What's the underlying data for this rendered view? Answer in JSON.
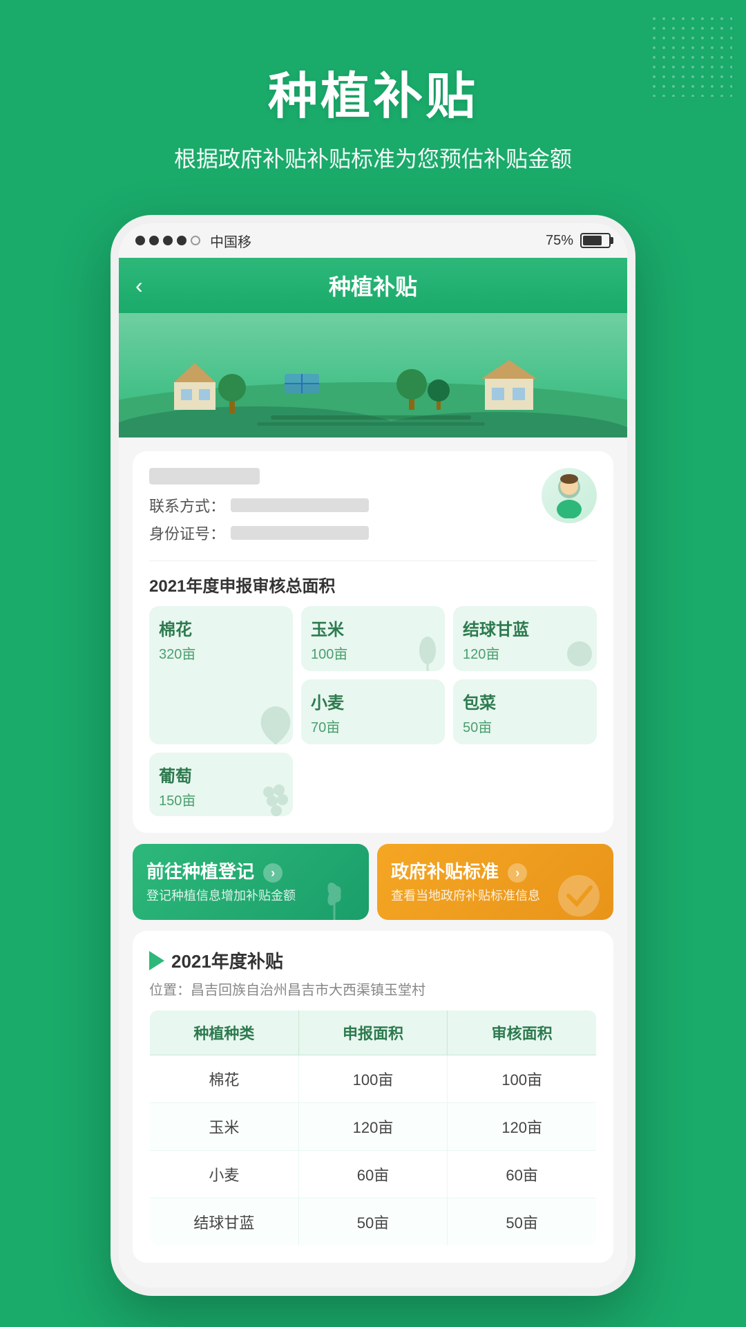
{
  "page": {
    "title": "种植补贴",
    "subtitle": "根据政府补贴补贴标准为您预估补贴金额",
    "bg_color": "#1aaa6a"
  },
  "status_bar": {
    "signals": [
      "filled",
      "filled",
      "filled",
      "filled",
      "empty"
    ],
    "carrier": "中国移",
    "battery_percent": "75%"
  },
  "app_header": {
    "back_label": "‹",
    "title": "种植补贴"
  },
  "user_card": {
    "contact_label": "联系方式：",
    "id_label": "身份证号："
  },
  "area_section": {
    "title": "2021年度申报审核总面积",
    "crops": [
      {
        "name": "棉花",
        "area": "320亩",
        "large": true
      },
      {
        "name": "玉米",
        "area": "100亩",
        "large": false
      },
      {
        "name": "结球甘蓝",
        "area": "120亩",
        "large": false
      },
      {
        "name": "小麦",
        "area": "70亩",
        "large": false
      },
      {
        "name": "包菜",
        "area": "50亩",
        "large": false
      },
      {
        "name": "葡萄",
        "area": "150亩",
        "large": false
      }
    ]
  },
  "action_buttons": [
    {
      "title": "前往种植登记",
      "subtitle": "登记种植信息增加补贴金额",
      "style": "green",
      "arrow": "›"
    },
    {
      "title": "政府补贴标准",
      "subtitle": "查看当地政府补贴标准信息",
      "style": "orange",
      "arrow": "›"
    }
  ],
  "subsidy_section": {
    "title": "2021年度补贴",
    "location_label": "位置：昌吉回族自治州昌吉市大西渠镇玉堂村",
    "table": {
      "headers": [
        "种植种类",
        "申报面积",
        "审核面积"
      ],
      "rows": [
        [
          "棉花",
          "100亩",
          "100亩"
        ],
        [
          "玉米",
          "120亩",
          "120亩"
        ],
        [
          "小麦",
          "60亩",
          "60亩"
        ],
        [
          "结球甘蓝",
          "50亩",
          "50亩"
        ]
      ]
    }
  }
}
